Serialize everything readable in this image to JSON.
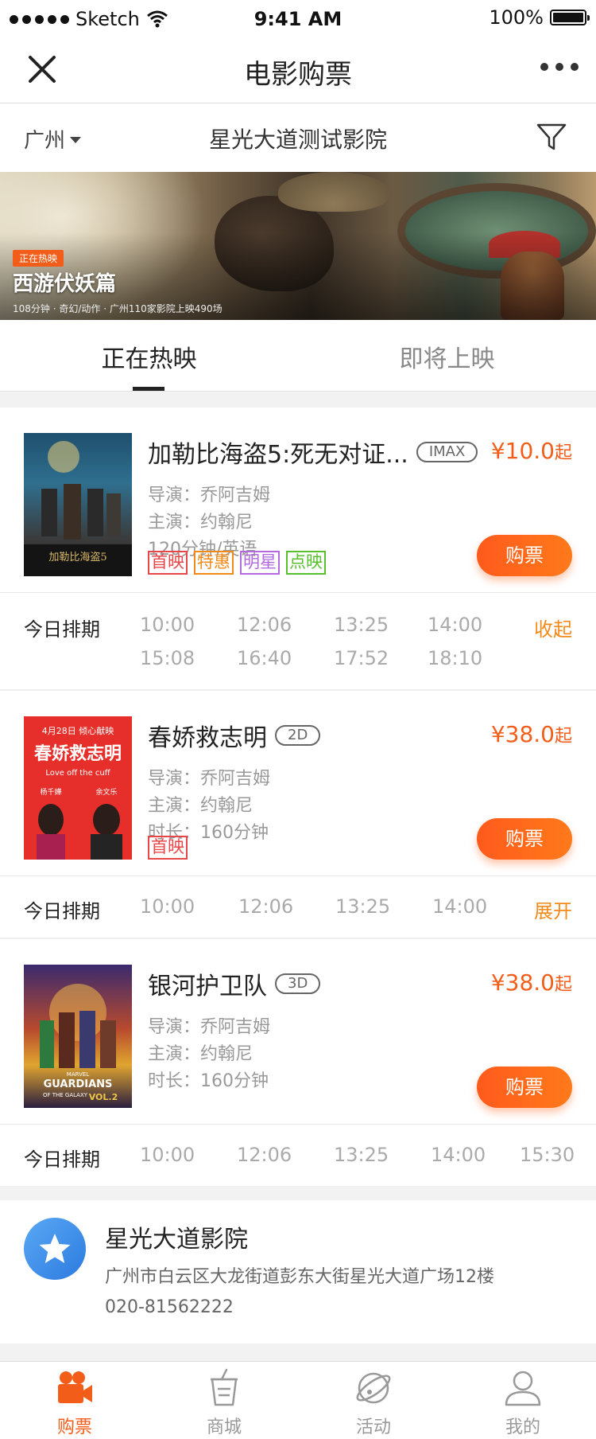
{
  "status_bar": {
    "carrier": "Sketch",
    "time": "9:41 AM",
    "battery": "100%"
  },
  "nav": {
    "title": "电影购票"
  },
  "cinema_bar": {
    "city": "广州",
    "cinema_name": "星光大道测试影院"
  },
  "banner": {
    "tag": "正在热映",
    "title": "西游伏妖篇",
    "info": "108分钟 · 奇幻/动作 · 广州110家影院上映490场"
  },
  "tabs": [
    {
      "label": "正在热映"
    },
    {
      "label": "即将上映"
    }
  ],
  "movies": [
    {
      "title": "加勒比海盗5:死无对证...",
      "format": "IMAX",
      "price": "¥10.0",
      "price_suffix": "起",
      "line1": "导演：乔阿吉姆",
      "line2": "主演：约翰尼",
      "line3": "120分钟/英语",
      "tags": [
        "首映",
        "特惠",
        "明星",
        "点映"
      ],
      "buy_label": "购票",
      "schedule_label": "今日排期",
      "times": [
        "10:00",
        "12:06",
        "13:25",
        "14:00",
        "15:08",
        "16:40",
        "17:52",
        "18:10"
      ],
      "toggle": "收起"
    },
    {
      "title": "春娇救志明",
      "format": "2D",
      "price": "¥38.0",
      "price_suffix": "起",
      "line1": "导演：乔阿吉姆",
      "line2": "主演：约翰尼",
      "line3": "时长：160分钟",
      "tags": [
        "首映"
      ],
      "buy_label": "购票",
      "schedule_label": "今日排期",
      "times": [
        "10:00",
        "12:06",
        "13:25",
        "14:00"
      ],
      "toggle": "展开",
      "poster_text": {
        "date": "4月28日 倾心献映",
        "title": "春娇救志明",
        "en": "Love off the cuff",
        "actor1": "杨千嬅",
        "actor2": "余文乐"
      }
    },
    {
      "title": "银河护卫队",
      "format": "3D",
      "price": "¥38.0",
      "price_suffix": "起",
      "line1": "导演：乔阿吉姆",
      "line2": "主演：约翰尼",
      "line3": "时长：160分钟",
      "buy_label": "购票",
      "schedule_label": "今日排期",
      "times": [
        "10:00",
        "12:06",
        "13:25",
        "14:00",
        "15:30"
      ],
      "poster_text": {
        "brand": "MARVEL",
        "title": "GUARDIANS",
        "sub": "OF THE GALAXY",
        "vol": "VOL.2"
      }
    }
  ],
  "cinema": {
    "name": "星光大道影院",
    "address": "广州市白云区大龙街道彭东大街星光大道广场12楼",
    "phone": "020-81562222"
  },
  "tabbar": [
    {
      "label": "购票",
      "icon": "camera-icon"
    },
    {
      "label": "商城",
      "icon": "cup-icon"
    },
    {
      "label": "活动",
      "icon": "planet-icon"
    },
    {
      "label": "我的",
      "icon": "user-icon"
    }
  ],
  "colors": {
    "accent": "#f25e1a",
    "toggle": "#f28a1a",
    "tag_premiere": "#e8474a",
    "tag_special": "#f28a1a",
    "tag_star": "#b36ae0",
    "tag_preview": "#58c02f"
  }
}
